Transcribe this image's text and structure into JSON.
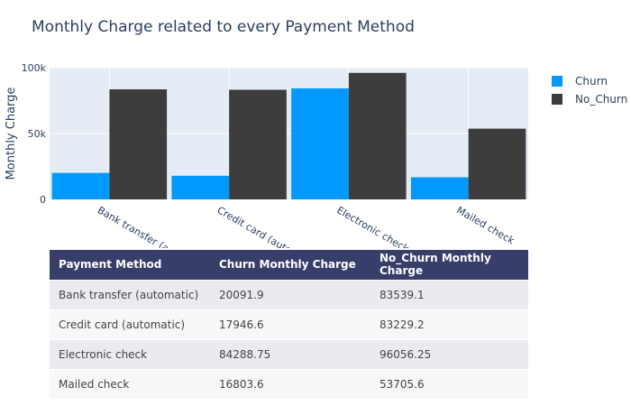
{
  "chart_data": {
    "type": "bar",
    "title": "Monthly Charge related to every Payment Method",
    "ylabel": "Monthly Charge",
    "xlabel": "",
    "categories": [
      "Bank transfer (automatic)",
      "Credit card (automatic)",
      "Electronic check",
      "Mailed check"
    ],
    "tick_labels_visible": [
      "Bank transfer (automatic)",
      "Credit card (automatic)",
      "Electronic check",
      "Mailed check"
    ],
    "series": [
      {
        "name": "Churn",
        "color": "#0099ff",
        "values": [
          20091.9,
          17946.6,
          84288.75,
          16803.6
        ]
      },
      {
        "name": "No_Churn",
        "color": "#3d3d3d",
        "values": [
          83539.1,
          83229.2,
          96056.25,
          53705.6
        ]
      }
    ],
    "ylim": [
      0,
      100000
    ],
    "yticks": [
      0,
      50000,
      100000
    ],
    "ytick_labels": [
      "0",
      "50k",
      "100k"
    ],
    "grid": true,
    "legend_position": "top-right"
  },
  "table": {
    "headers": [
      "Payment Method",
      "Churn Monthly Charge",
      "No_Churn Monthly Charge"
    ],
    "rows": [
      [
        "Bank transfer (automatic)",
        "20091.9",
        "83539.1"
      ],
      [
        "Credit card (automatic)",
        "17946.6",
        "83229.2"
      ],
      [
        "Electronic check",
        "84288.75",
        "96056.25"
      ],
      [
        "Mailed check",
        "16803.6",
        "53705.6"
      ]
    ]
  },
  "colors": {
    "plot_bg": "#e5ecf6",
    "grid": "#ffffff",
    "table_header_bg": "#373e6a"
  }
}
